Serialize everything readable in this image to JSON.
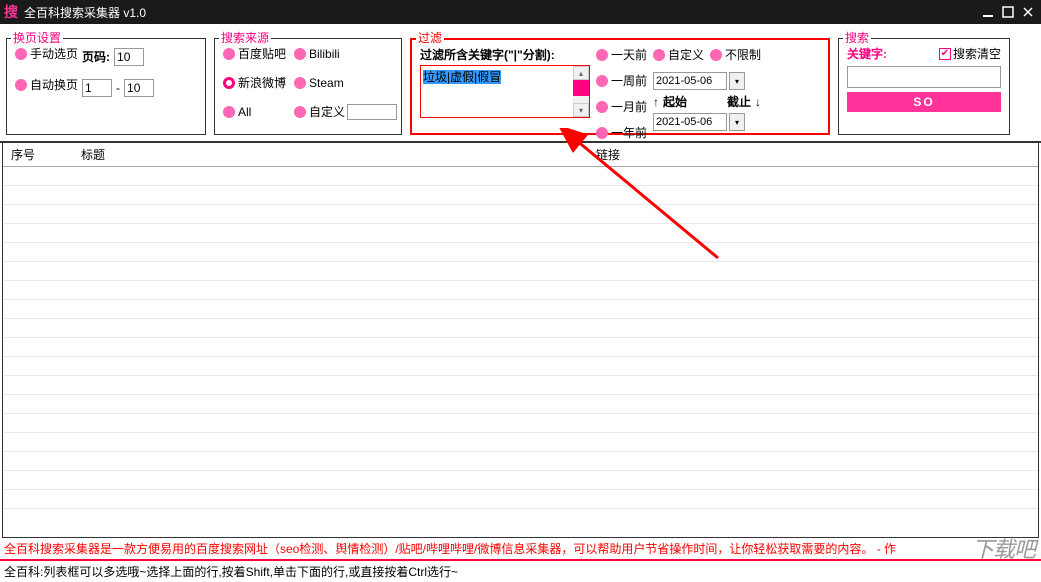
{
  "titlebar": {
    "logo": "搜",
    "title": "全百科搜索采集器 v1.0"
  },
  "groups": {
    "page": {
      "title": "换页设置",
      "manual": "手动选页",
      "page_label": "页码:",
      "page_value": "10",
      "auto": "自动换页",
      "from": "1",
      "dash": "-",
      "to": "10"
    },
    "source": {
      "title": "搜索来源",
      "items": [
        "百度贴吧",
        "Bilibili",
        "新浪微博",
        "Steam",
        "All",
        "自定义"
      ],
      "custom_value": ""
    },
    "filter": {
      "title": "过滤",
      "label": "过滤所含关键字(\"|\"分割):",
      "text": "垃圾|虚假|假冒",
      "time_opts": [
        "一天前",
        "一周前",
        "一月前",
        "一年前"
      ],
      "right_opts": [
        "自定义",
        "不限制"
      ],
      "date1": "2021-05-06",
      "start": "起始",
      "end": "截止",
      "date2": "2021-05-06"
    },
    "search": {
      "title": "搜索",
      "kw_label": "关键字:",
      "clear_label": "搜索清空",
      "button": "SO"
    }
  },
  "table": {
    "cols": [
      "序号",
      "标题",
      "链接"
    ]
  },
  "footer": {
    "line1": "全百科搜索采集器是一款方便易用的百度搜索网址（seo检测、舆情检测）/贴吧/哔哩哔哩/微博信息采集器，可以帮助用户节省操作时间，让你轻松获取需要的内容。 - 作",
    "line2": "全百科:列表框可以多选哦~选择上面的行,按着Shift,单击下面的行,或直接按着Ctrl选行~"
  },
  "watermark": "下载吧"
}
